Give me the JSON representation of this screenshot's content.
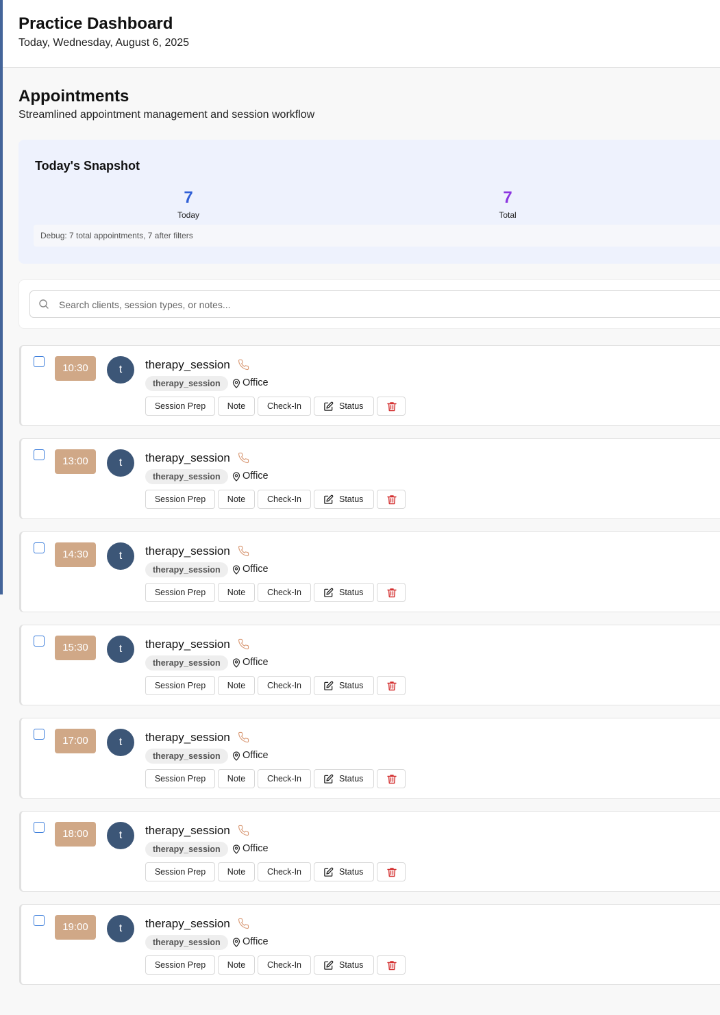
{
  "header": {
    "title": "Practice Dashboard",
    "date": "Today, Wednesday, August 6, 2025"
  },
  "section": {
    "title": "Appointments",
    "description": "Streamlined appointment management and session workflow"
  },
  "snapshot": {
    "title": "Today's Snapshot",
    "today_count": "7",
    "today_label": "Today",
    "total_count": "7",
    "total_label": "Total",
    "debug": "Debug: 7 total appointments, 7 after filters"
  },
  "search": {
    "placeholder": "Search clients, session types, or notes..."
  },
  "buttons": {
    "session_prep": "Session Prep",
    "note": "Note",
    "check_in": "Check-In",
    "status": "Status"
  },
  "colors": {
    "accent_blue": "#2f5fd6",
    "accent_purple": "#8b35e0",
    "time_badge": "#d0a887",
    "avatar": "#3c5677",
    "delete_red": "#d32f2f"
  },
  "appointments": [
    {
      "time": "10:30",
      "avatar": "t",
      "name": "therapy_session",
      "type": "therapy_session",
      "location": "Office"
    },
    {
      "time": "13:00",
      "avatar": "t",
      "name": "therapy_session",
      "type": "therapy_session",
      "location": "Office"
    },
    {
      "time": "14:30",
      "avatar": "t",
      "name": "therapy_session",
      "type": "therapy_session",
      "location": "Office"
    },
    {
      "time": "15:30",
      "avatar": "t",
      "name": "therapy_session",
      "type": "therapy_session",
      "location": "Office"
    },
    {
      "time": "17:00",
      "avatar": "t",
      "name": "therapy_session",
      "type": "therapy_session",
      "location": "Office"
    },
    {
      "time": "18:00",
      "avatar": "t",
      "name": "therapy_session",
      "type": "therapy_session",
      "location": "Office"
    },
    {
      "time": "19:00",
      "avatar": "t",
      "name": "therapy_session",
      "type": "therapy_session",
      "location": "Office"
    }
  ]
}
